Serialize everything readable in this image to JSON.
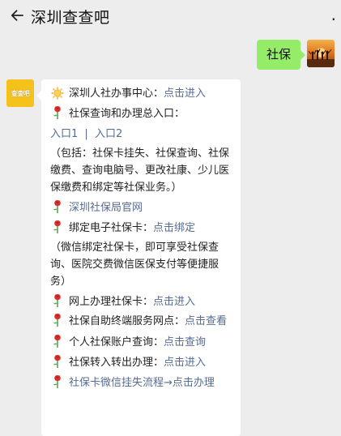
{
  "header": {
    "title": "深圳查查吧",
    "more": "."
  },
  "me": {
    "message": "社保"
  },
  "bot": {
    "avatar_text": "查查吧",
    "items": [
      {
        "icon": "sun-icon",
        "label": "深圳人社办事中心：",
        "link": "点击进入"
      },
      {
        "icon": "rose-icon",
        "label": "社保查询和办理总入口："
      },
      {
        "link1": "入口1",
        "sep": "|",
        "link2": "入口2"
      },
      {
        "text": "（包括：社保卡挂失、社保查询、社保缴费、查询电脑号、更改社康、少儿医保缴费和绑定等社保业务。）"
      },
      {
        "icon": "rose-icon",
        "link": "深圳社保局官网"
      },
      {
        "icon": "rose-icon",
        "label": "绑定电子社保卡：",
        "link": "点击绑定"
      },
      {
        "text": "（微信绑定社保卡，即可享受社保查询、医院交费微信医保支付等便捷服务）"
      },
      {
        "icon": "rose-icon",
        "label": "网上办理社保卡：",
        "link": "点击进入"
      },
      {
        "icon": "rose-icon",
        "label": "社保自助终端服务网点：",
        "link": "点击查看"
      },
      {
        "icon": "rose-icon",
        "label": "个人社保账户查询：",
        "link": "点击查询"
      },
      {
        "icon": "rose-icon",
        "label": "社保转入转出办理：",
        "link": "点击进入"
      },
      {
        "icon": "rose-icon",
        "link": "社保卡微信挂失流程→点击办理"
      }
    ]
  },
  "colors": {
    "link": "#576b95",
    "me_bubble": "#95ec69",
    "bg": "#ededed"
  }
}
